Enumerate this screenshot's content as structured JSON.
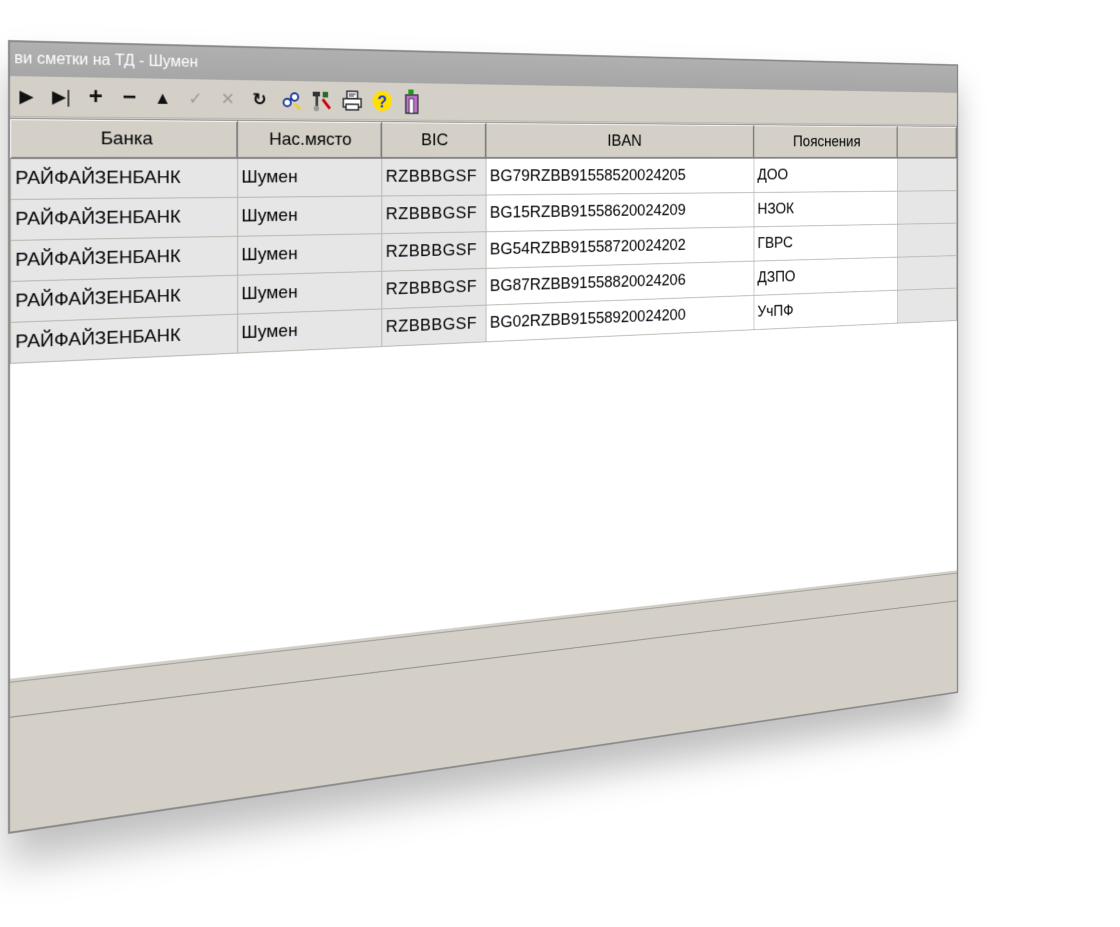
{
  "window": {
    "title": "ви сметки на ТД - Шумен"
  },
  "toolbar": {
    "items": [
      {
        "name": "next",
        "glyph": "▶"
      },
      {
        "name": "last",
        "glyph": "▶|"
      },
      {
        "name": "insert",
        "glyph": "+"
      },
      {
        "name": "delete",
        "glyph": "−"
      },
      {
        "name": "edit",
        "glyph": "▲"
      },
      {
        "name": "post",
        "glyph": "✓"
      },
      {
        "name": "cancel",
        "glyph": "✕"
      },
      {
        "name": "refresh",
        "glyph": "↻"
      }
    ]
  },
  "grid": {
    "columns": [
      "Банка",
      "Нас.място",
      "BIC",
      "IBAN",
      "Пояснения"
    ],
    "rows": [
      {
        "bank": "РАЙФАЙЗЕНБАНК",
        "place": "Шумен",
        "bic": "RZBBBGSF",
        "iban": "BG79RZBB91558520024205",
        "note": "ДОО"
      },
      {
        "bank": "РАЙФАЙЗЕНБАНК",
        "place": "Шумен",
        "bic": "RZBBBGSF",
        "iban": "BG15RZBB91558620024209",
        "note": "НЗОК"
      },
      {
        "bank": "РАЙФАЙЗЕНБАНК",
        "place": "Шумен",
        "bic": "RZBBBGSF",
        "iban": "BG54RZBB91558720024202",
        "note": "ГВРС"
      },
      {
        "bank": "РАЙФАЙЗЕНБАНК",
        "place": "Шумен",
        "bic": "RZBBBGSF",
        "iban": "BG87RZBB91558820024206",
        "note": "ДЗПО"
      },
      {
        "bank": "РАЙФАЙЗЕНБАНК",
        "place": "Шумен",
        "bic": "RZBBBGSF",
        "iban": "BG02RZBB91558920024200",
        "note": "УчПФ"
      }
    ]
  },
  "colors": {
    "cell_grey": "#e6e6e6",
    "chrome": "#d4d0c8",
    "help_icon": "#ffe000"
  }
}
